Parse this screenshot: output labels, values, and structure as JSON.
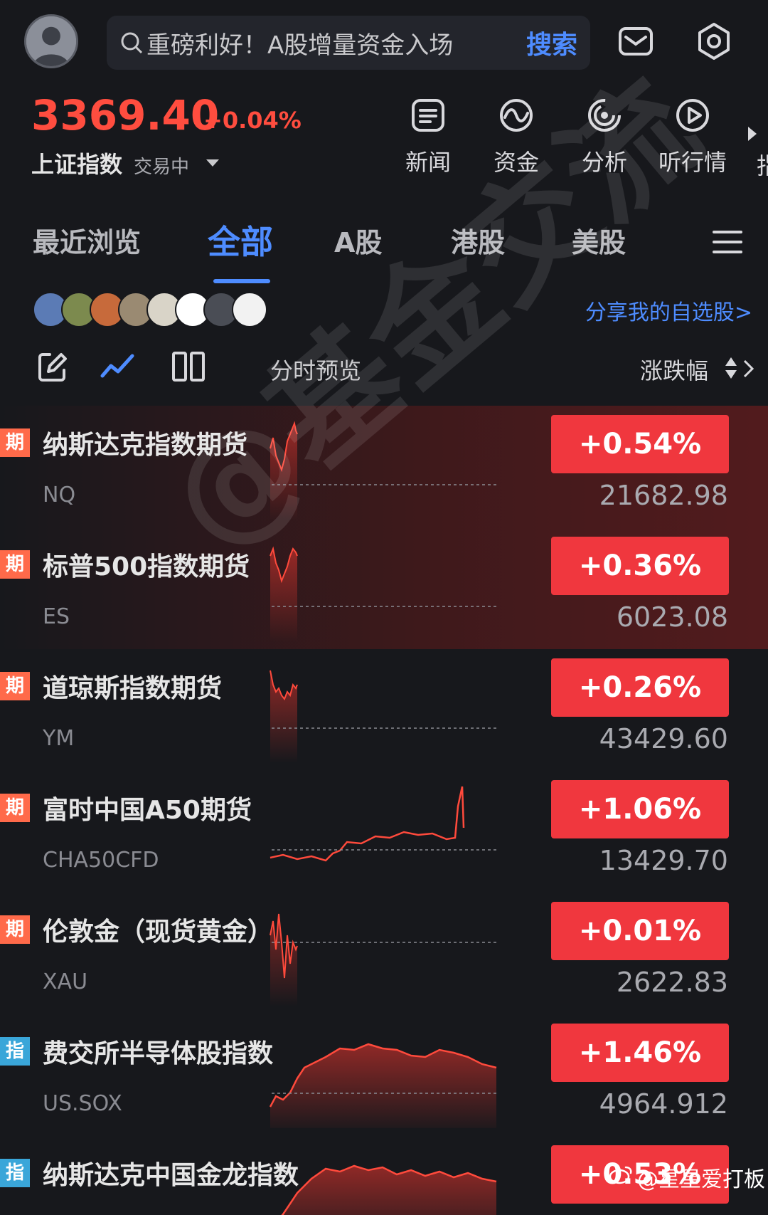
{
  "search": {
    "placeholder": "重磅利好！A股增量资金入场",
    "button": "搜索"
  },
  "index": {
    "value": "3369.40",
    "change": "+0.04%",
    "name": "上证指数",
    "status": "交易中"
  },
  "quick_actions": [
    {
      "label": "新闻",
      "icon": "news-icon"
    },
    {
      "label": "资金",
      "icon": "fund-flow-icon"
    },
    {
      "label": "分析",
      "icon": "analysis-icon"
    },
    {
      "label": "听行情",
      "icon": "play-icon"
    }
  ],
  "quick_partial": "指",
  "tabs": [
    {
      "label": "最近浏览"
    },
    {
      "label": "全部",
      "active": true
    },
    {
      "label": "A股"
    },
    {
      "label": "港股"
    },
    {
      "label": "美股"
    }
  ],
  "share": {
    "label": "分享我的自选股>"
  },
  "toolbar": {
    "preview_label": "分时预览",
    "sort_label": "涨跌幅"
  },
  "rows": [
    {
      "tag": "期",
      "tag_type": "futures",
      "name": "纳斯达克指数期货",
      "code": "NQ",
      "change": "+0.54%",
      "price": "21682.98",
      "highlight": true
    },
    {
      "tag": "期",
      "tag_type": "futures",
      "name": "标普500指数期货",
      "code": "ES",
      "change": "+0.36%",
      "price": "6023.08",
      "highlight": true
    },
    {
      "tag": "期",
      "tag_type": "futures",
      "name": "道琼斯指数期货",
      "code": "YM",
      "change": "+0.26%",
      "price": "43429.60",
      "highlight": false
    },
    {
      "tag": "期",
      "tag_type": "futures",
      "name": "富时中国A50期货",
      "code": "CHA50CFD",
      "change": "+1.06%",
      "price": "13429.70",
      "highlight": false
    },
    {
      "tag": "期",
      "tag_type": "futures",
      "name": "伦敦金（现货黄金）",
      "code": "XAU",
      "change": "+0.01%",
      "price": "2622.83",
      "highlight": false
    },
    {
      "tag": "指",
      "tag_type": "index",
      "name": "费交所半导体股指数",
      "code": "US.SOX",
      "change": "+1.46%",
      "price": "4964.912",
      "highlight": false
    },
    {
      "tag": "指",
      "tag_type": "index",
      "name": "纳斯达克中国金龙指数",
      "code": "",
      "change": "+0.53%",
      "price": "",
      "highlight": false
    }
  ],
  "watermark": {
    "main": "@基金交流",
    "weibo": "@星星爱打板"
  },
  "colors": {
    "up": "#f0373e",
    "accent": "#4e8cff",
    "background": "#17181c"
  }
}
